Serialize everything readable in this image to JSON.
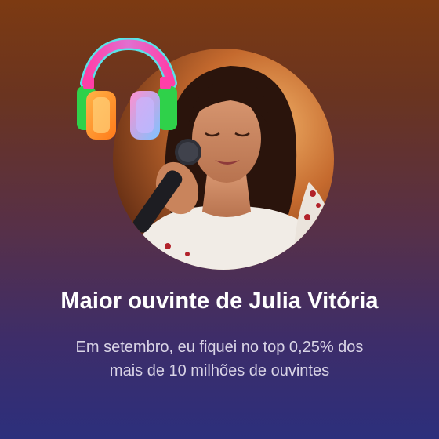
{
  "card": {
    "title": "Maior ouvinte de Julia Vitória",
    "subtitle_line1": "Em setembro, eu fiquei no top 0,25% dos",
    "subtitle_line2": "mais de 10 milhões de ouvintes"
  },
  "media": {
    "artist_photo": "artist-photo",
    "decoration": "headphones-icon"
  },
  "colors": {
    "bg_top": "#7c3a12",
    "bg_bottom": "#2c2f7c",
    "text": "#ffffff",
    "subtext": "#d9d4e6"
  }
}
